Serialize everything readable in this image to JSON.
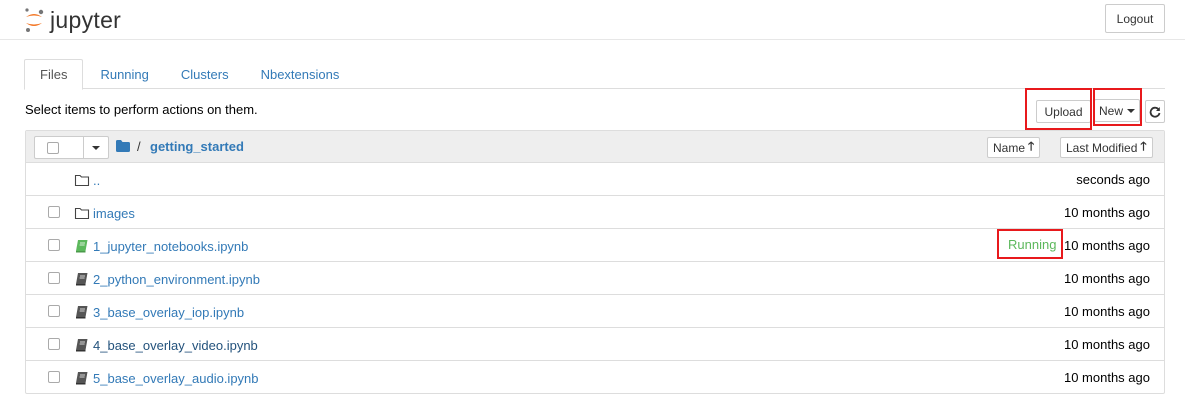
{
  "header": {
    "logo_text": "jupyter",
    "logout_label": "Logout"
  },
  "tabs": [
    {
      "label": "Files",
      "active": true
    },
    {
      "label": "Running",
      "active": false
    },
    {
      "label": "Clusters",
      "active": false
    },
    {
      "label": "Nbextensions",
      "active": false
    }
  ],
  "toolbar": {
    "select_hint": "Select items to perform actions on them.",
    "upload_label": "Upload",
    "new_label": "New"
  },
  "list_header": {
    "separator": "/",
    "current_dir": "getting_started",
    "sort_name_label": "Name",
    "sort_modified_label": "Last Modified"
  },
  "rows": [
    {
      "name": "..",
      "type": "folder",
      "modified": "seconds ago",
      "checkbox": false
    },
    {
      "name": "images",
      "type": "folder",
      "modified": "10 months ago",
      "checkbox": true
    },
    {
      "name": "1_jupyter_notebooks.ipynb",
      "type": "notebook-running",
      "modified": "10 months ago",
      "status": "Running",
      "checkbox": true
    },
    {
      "name": "2_python_environment.ipynb",
      "type": "notebook",
      "modified": "10 months ago",
      "checkbox": true
    },
    {
      "name": "3_base_overlay_iop.ipynb",
      "type": "notebook",
      "modified": "10 months ago",
      "checkbox": true
    },
    {
      "name": "4_base_overlay_video.ipynb",
      "type": "notebook",
      "modified": "10 months ago",
      "checkbox": true
    },
    {
      "name": "5_base_overlay_audio.ipynb",
      "type": "notebook",
      "modified": "10 months ago",
      "checkbox": true
    }
  ],
  "colors": {
    "link": "#337ab7",
    "running": "#5cb85c",
    "highlight": "#e8191c",
    "logo_orange": "#f37726"
  }
}
